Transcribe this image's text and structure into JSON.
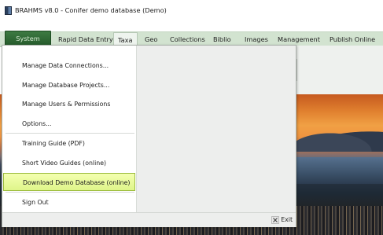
{
  "window": {
    "title": "BRAHMS v8.0 - Conifer demo database (Demo)",
    "icon": "app-icon"
  },
  "tabs": [
    {
      "label": "System",
      "active": true
    },
    {
      "label": "Rapid Data Entry"
    },
    {
      "label": "Taxa",
      "selected": true
    },
    {
      "label": "Geo"
    },
    {
      "label": "Collections"
    },
    {
      "label": "Biblio"
    },
    {
      "label": "Images"
    },
    {
      "label": "Management"
    },
    {
      "label": "Publish Online"
    }
  ],
  "system_menu": {
    "items": [
      {
        "label": "Manage Data Connections..."
      },
      {
        "label": "Manage Database Projects..."
      },
      {
        "label": "Manage Users & Permissions"
      },
      {
        "label": "Options..."
      },
      {
        "label": "Training Guide (PDF)"
      },
      {
        "label": "Short Video Guides (online)"
      },
      {
        "label": "Download Demo Database (online)",
        "highlighted": true
      },
      {
        "label": "Sign Out"
      }
    ],
    "exit_label": "Exit",
    "exit_icon": "close-x-icon"
  },
  "colors": {
    "system_tab": "#2f6b35",
    "tabbar_bg": "#d2e3d0",
    "highlight": "#e8f7a0"
  }
}
